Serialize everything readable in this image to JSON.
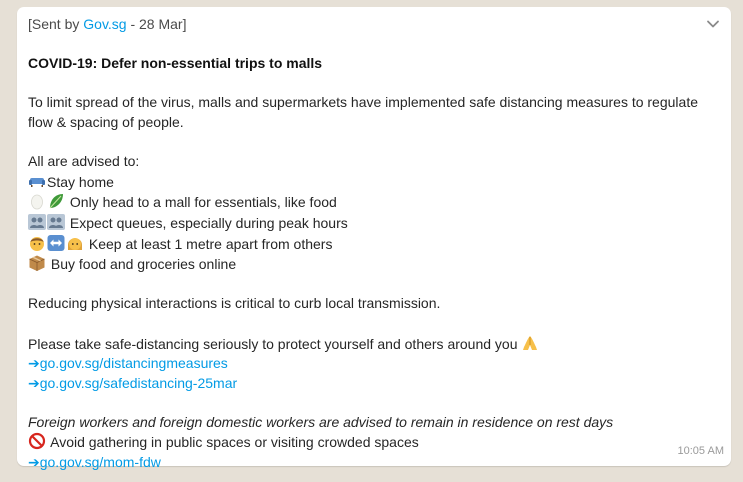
{
  "message": {
    "sent_by_prefix": "[Sent by ",
    "sender_link": "Gov.sg",
    "sent_by_suffix": " - 28 Mar]",
    "title": "COVID-19: Defer non-essential trips to malls",
    "intro": "To limit spread of the virus, malls and supermarkets have implemented safe distancing measures to regulate flow & spacing of people.",
    "advised": "All are advised to:",
    "tips": [
      {
        "icons": [
          "sofa-icon"
        ],
        "text": "Stay home"
      },
      {
        "icons": [
          "egg-icon",
          "leafy-green-icon"
        ],
        "text": " Only head to a mall for essentials, like food"
      },
      {
        "icons": [
          "people-icon",
          "people-icon"
        ],
        "text": " Expect queues, especially during peak hours"
      },
      {
        "icons": [
          "man-icon",
          "left-right-arrow-icon",
          "woman-icon"
        ],
        "text": " Keep at least 1 metre apart from others"
      },
      {
        "icons": [
          "package-icon"
        ],
        "text": " Buy food and groceries online"
      }
    ],
    "reducing": "Reducing physical interactions is critical to curb local transmission.",
    "please": "Please take safe-distancing seriously to protect yourself and others around you ",
    "please_icon": "folded-hands-icon",
    "links1": [
      "➔go.gov.sg/distancingmeasures",
      "➔go.gov.sg/safedistancing-25mar"
    ],
    "foreign": "Foreign workers and foreign domestic workers are advised to remain in residence on rest days",
    "avoid_icon": "prohibited-icon",
    "avoid": " Avoid gathering in public spaces or visiting crowded spaces",
    "link_mom": "➔go.gov.sg/mom-fdw",
    "time": "10:05 AM",
    "menu_icon": "chevron-down-icon"
  },
  "colors": {
    "link": "#039be5",
    "bubble": "#ffffff",
    "background": "#e6e0d6",
    "timestamp": "#9a9a9a"
  }
}
